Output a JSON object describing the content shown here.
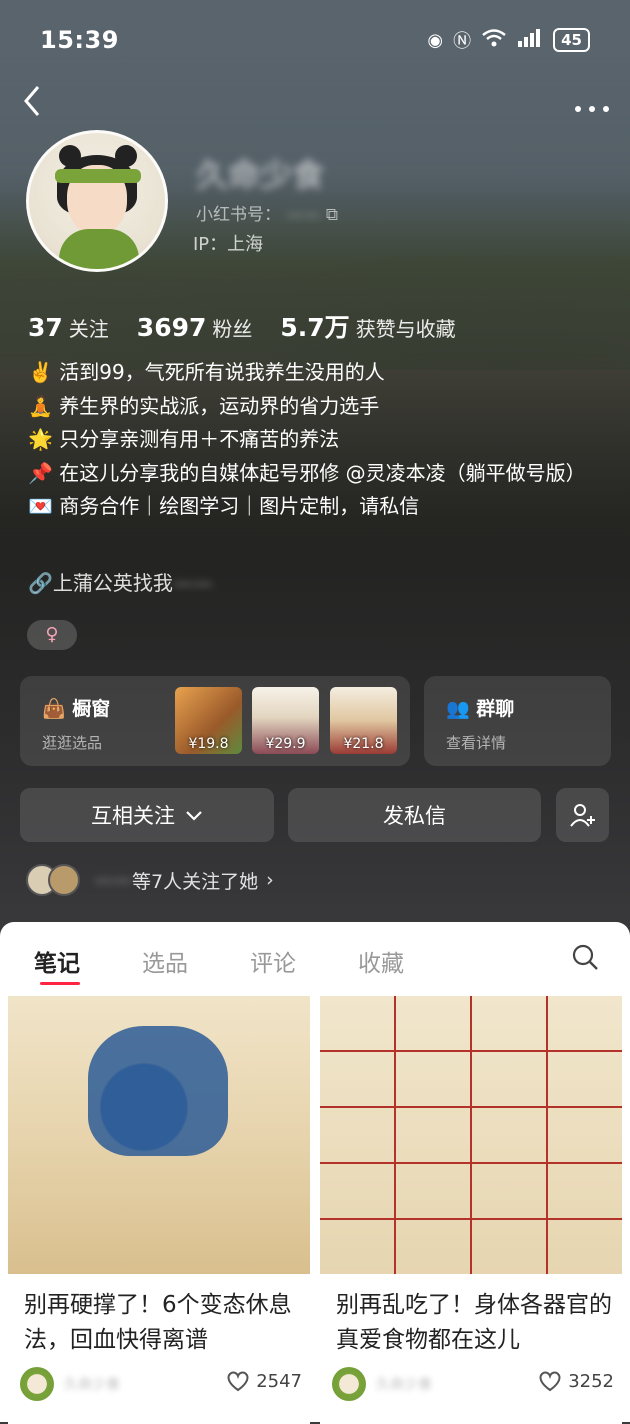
{
  "status": {
    "time": "15:39",
    "battery": "45"
  },
  "profile": {
    "name": "久命少食",
    "account_label": "小红书号：",
    "account_value": "——",
    "ip": "IP：上海",
    "stats": [
      {
        "num": "37",
        "label": "关注"
      },
      {
        "num": "3697",
        "label": "粉丝"
      },
      {
        "num": "5.7万",
        "label": "获赞与收藏"
      }
    ],
    "bio": [
      "✌️ 活到99，气死所有说我养生没用的人",
      "🧘 养生界的实战派，运动界的省力选手",
      "🌟 只分享亲测有用＋不痛苦的养法",
      "📌 在这儿分享我的自媒体起号邪修 @灵凌本凌（躺平做号版）",
      "💌 商务合作｜绘图学习｜图片定制，请私信"
    ],
    "link": "上蒲公英找我",
    "link_blur": "——",
    "gender": "♀"
  },
  "shop": {
    "title": "橱窗",
    "sub": "逛逛选品",
    "prices": [
      "¥19.8",
      "¥29.9",
      "¥21.8"
    ]
  },
  "group": {
    "title": "群聊",
    "sub": "查看详情"
  },
  "buttons": {
    "follow": "互相关注",
    "message": "发私信"
  },
  "mutual": {
    "blurred": "——",
    "text": "等7人关注了她"
  },
  "tabs": [
    "笔记",
    "选品",
    "评论",
    "收藏"
  ],
  "notes": [
    {
      "title": "别再硬撑了！6个变态休息法，回血快得离谱",
      "author": "久命少食",
      "likes": "2547"
    },
    {
      "title": "别再乱吃了！身体各器官的真爱食物都在这儿",
      "author": "久命少食",
      "likes": "3252"
    }
  ]
}
